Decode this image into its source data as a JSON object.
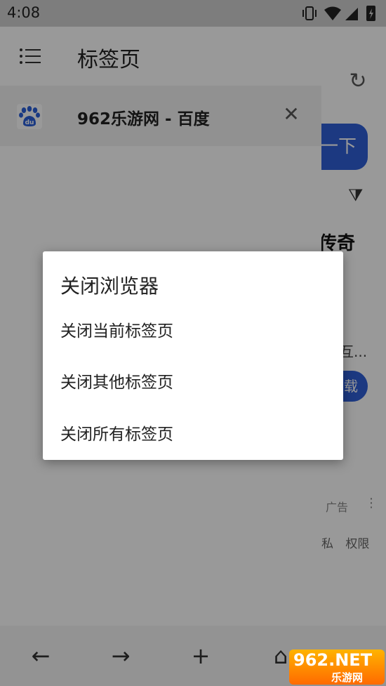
{
  "status_bar": {
    "time": "4:08"
  },
  "background_page": {
    "search_button": "一下",
    "result_title": "传奇",
    "snippet": "互...",
    "download_button": "载",
    "ad_label": "广告",
    "more": "⋮",
    "footer_links": [
      "私",
      "权限"
    ]
  },
  "drawer": {
    "title": "标签页",
    "tabs": [
      {
        "title": "962乐游网 - 百度",
        "favicon": "baidu-icon"
      }
    ]
  },
  "toolbar": {
    "back": "←",
    "forward": "→",
    "new_tab": "+",
    "home": "⌂",
    "tabs": "≡"
  },
  "dialog": {
    "title": "关闭浏览器",
    "items": [
      "关闭当前标签页",
      "关闭其他标签页",
      "关闭所有标签页"
    ]
  },
  "watermark": {
    "top": "962.NET",
    "bottom": "乐游网"
  }
}
